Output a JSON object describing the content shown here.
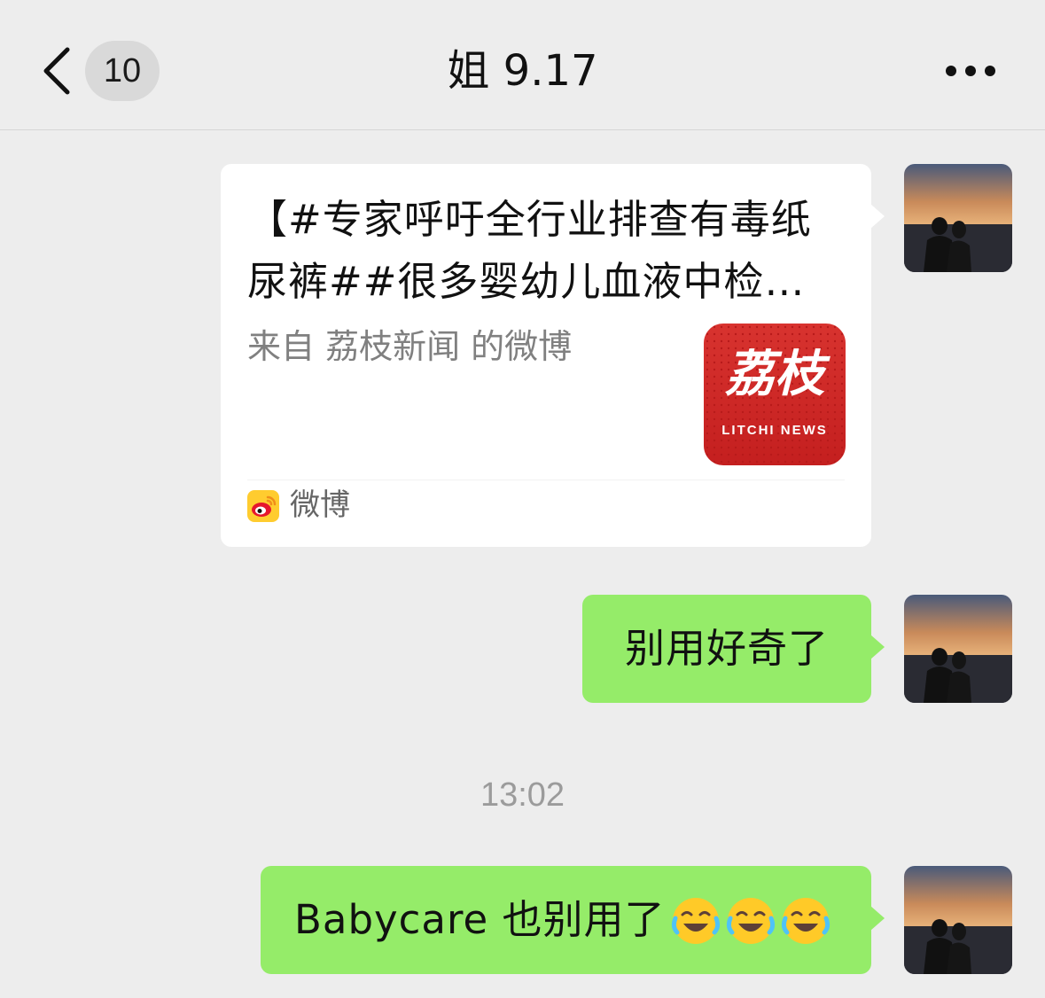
{
  "header": {
    "back_label": "back",
    "unread_count": "10",
    "title": "姐 9.17",
    "more_label": "more"
  },
  "messages": [
    {
      "type": "link-card",
      "title": "【#专家呼吁全行业排查有毒纸尿裤##很多婴幼儿血液中检…",
      "source": "来自 荔枝新闻 的微博",
      "thumb_cn": "荔枝",
      "thumb_en": "LITCHI NEWS",
      "app_name": "微博"
    },
    {
      "type": "text",
      "text": "别用好奇了"
    },
    {
      "type": "time",
      "text": "13:02"
    },
    {
      "type": "text",
      "text": "Babycare 也别用了",
      "emojis": [
        "face-with-tears-of-joy-icon",
        "face-with-tears-of-joy-icon",
        "face-with-tears-of-joy-icon"
      ]
    }
  ],
  "colors": {
    "background": "#ededed",
    "bubble_self": "#95ec69",
    "card": "#ffffff",
    "thumb_red": "#d32f2f",
    "weibo_yellow": "#ffcc2f"
  }
}
